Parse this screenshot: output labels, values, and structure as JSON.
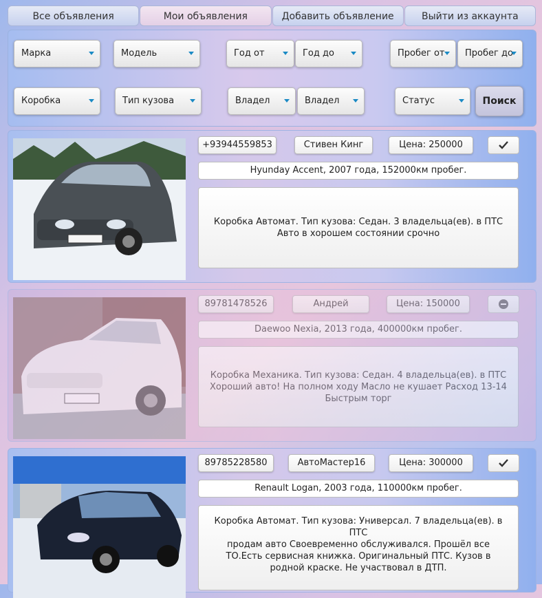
{
  "nav": {
    "tabs": [
      "Все объявления",
      "Мои объявления",
      "Добавить объявление",
      "Выйти из аккаунта"
    ]
  },
  "filters": {
    "brand": "Марка",
    "model": "Модель",
    "year_from": "Год от",
    "year_to": "Год до",
    "mileage_from": "Пробег от",
    "mileage_to": "Пробег до",
    "gearbox": "Коробка",
    "body_type": "Тип кузова",
    "owners_1": "Владел",
    "owners_2": "Владел",
    "status": "Статус",
    "search_label": "Поиск"
  },
  "listings": [
    {
      "phone": "+93944559853",
      "seller": "Стивен Кинг",
      "price": "Цена: 250000",
      "title": "Hyunday Accent, 2007 года, 152000км пробег.",
      "desc_line1": "Коробка Автомат. Тип кузова: Седан. 3 владельца(ев). в ПТС",
      "desc_line2": "Авто в хорошем состоянии срочно",
      "status_icon": "check-icon",
      "car_color": "#4a5055"
    },
    {
      "phone": "89781478526",
      "seller": "Андрей",
      "price": "Цена: 150000",
      "title": "Daewoo Nexia, 2013 года, 400000км пробег.",
      "desc_line1": "Коробка Механика. Тип кузова: Седан. 4 владельца(ев). в ПТС",
      "desc_line2": "Хороший авто! На полном ходу Масло не кушает Расход 13-14 Быстрым торг",
      "status_icon": "minus-circle-icon",
      "car_color": "#f2f2f2"
    },
    {
      "phone": "89785228580",
      "seller": "АвтоМастер16",
      "price": "Цена: 300000",
      "title": "Renault Logan, 2003 года, 110000км пробег.",
      "desc_line1": "Коробка Автомат. Тип кузова: Универсал. 7 владельца(ев). в ПТС",
      "desc_line2": "продам авто Своевременно обслуживался. Прошёл все ТО.Есть сервисная книжка. Оригинальный ПТС. Кузов в родной краске. Не участвовал в ДТП.",
      "status_icon": "check-icon",
      "car_color": "#1a2233"
    }
  ]
}
